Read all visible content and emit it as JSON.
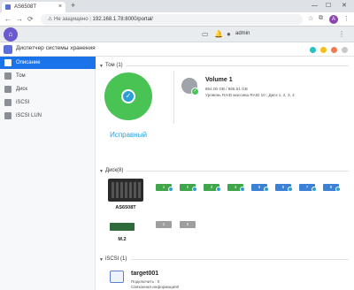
{
  "browser": {
    "tab_title": "AS6508T",
    "new_tab": "+",
    "not_secure": "Не защищено",
    "url": "192.168.1.78:8000/portal/",
    "profile_letter": "A"
  },
  "topbar": {
    "user": "admin"
  },
  "app": {
    "title": "Диспетчер системы хранения",
    "dot_colors": [
      "#25c2c2",
      "#f5c018",
      "#ec7b5a",
      "#c8c8c8"
    ]
  },
  "sidebar": {
    "items": [
      {
        "label": "Описание",
        "icon": "overview-icon",
        "active": true
      },
      {
        "label": "Том",
        "icon": "volume-icon",
        "active": false
      },
      {
        "label": "Диск",
        "icon": "disk-icon",
        "active": false
      },
      {
        "label": "iSCSI",
        "icon": "iscsi-icon",
        "active": false
      },
      {
        "label": "iSCSI LUN",
        "icon": "lun-icon",
        "active": false
      }
    ]
  },
  "volume_section": {
    "header": "Том (1)",
    "health": "Исправный",
    "volume_name": "Volume 1",
    "volume_size": "854.00 GB / 865.51 GB",
    "volume_raid": "Уровень RAID массива RAID 10 ; Диск 1, 2, 3, 4"
  },
  "disk_section": {
    "header": "Диск(8)",
    "nas_model": "AS6508T",
    "m2_label": "M.2",
    "bays": [
      "1",
      "2",
      "3",
      "4",
      "5",
      "6",
      "7",
      "8"
    ],
    "bay_colors": [
      "green",
      "green",
      "green",
      "green",
      "blue",
      "blue",
      "blue",
      "blue"
    ],
    "m2_slots": [
      "1",
      "2"
    ]
  },
  "iscsi_section": {
    "header": "iSCSI (1)",
    "target_name": "target001",
    "connected": "Подключить : 0",
    "status": "Связанная информация0"
  }
}
